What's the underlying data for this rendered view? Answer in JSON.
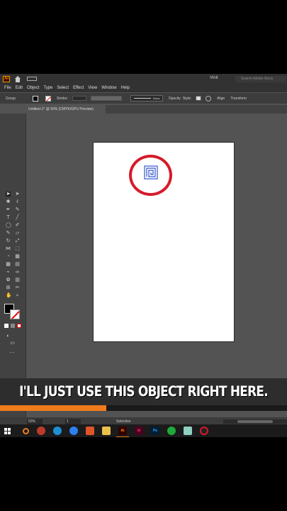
{
  "app": {
    "badge": "Ai",
    "workspace": "Vinit",
    "search_placeholder": "Search Adobe Stock"
  },
  "menu": [
    "File",
    "Edit",
    "Object",
    "Type",
    "Select",
    "Effect",
    "View",
    "Window",
    "Help"
  ],
  "control_bar": {
    "selection_label": "Group",
    "stroke_label": "Stroke:",
    "brush_label": "Basic",
    "opacity_label": "Opacity",
    "style_label": "Style:",
    "align_label": "Align",
    "transform_label": "Transform"
  },
  "document_tab": "Untitled-1* @ 50% (CMYK/GPU Preview)",
  "status": {
    "zoom": "50%",
    "page": "1",
    "tool": "Selection"
  },
  "caption": "I'LL JUST USE THIS OBJECT RIGHT HERE.",
  "video_progress_percent": 37,
  "colors": {
    "accent": "#f07b1c",
    "highlight_circle": "#d61a2a"
  },
  "taskbar": [
    "windows-start",
    "search",
    "chrome",
    "edge",
    "firefox",
    "brave",
    "file-explorer",
    "illustrator",
    "indesign",
    "photoshop",
    "whatsapp",
    "app",
    "recorder"
  ]
}
